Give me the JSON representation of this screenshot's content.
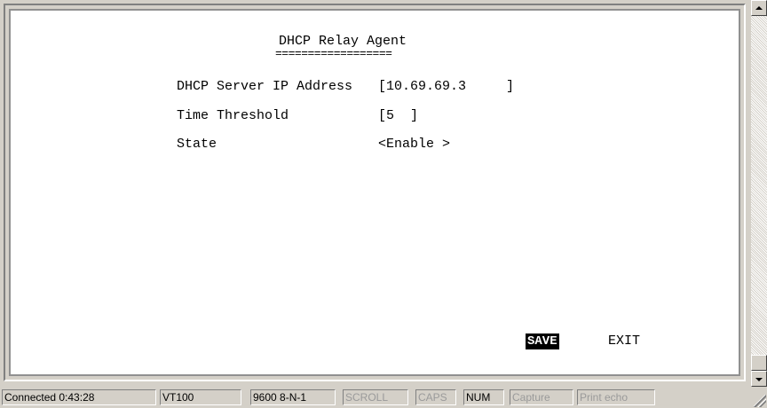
{
  "screen": {
    "title": "DHCP Relay Agent",
    "title_underline": "==================",
    "fields": [
      {
        "label": "DHCP Server IP Address",
        "value": "[10.69.69.3     ]"
      },
      {
        "label": "Time Threshold",
        "value": "[5  ]"
      },
      {
        "label": "State",
        "value": "<Enable >"
      }
    ],
    "actions": {
      "save": "SAVE",
      "exit": "EXIT"
    }
  },
  "status_bar": {
    "connection": "Connected 0:43:28",
    "emulation": "VT100",
    "port_settings": "9600 8-N-1",
    "scroll": "SCROLL",
    "caps": "CAPS",
    "num": "NUM",
    "capture": "Capture",
    "print_echo": "Print echo"
  },
  "icons": {
    "scroll_up": "arrow-up-icon",
    "scroll_down": "arrow-down-icon",
    "resize": "resize-grip-icon"
  }
}
